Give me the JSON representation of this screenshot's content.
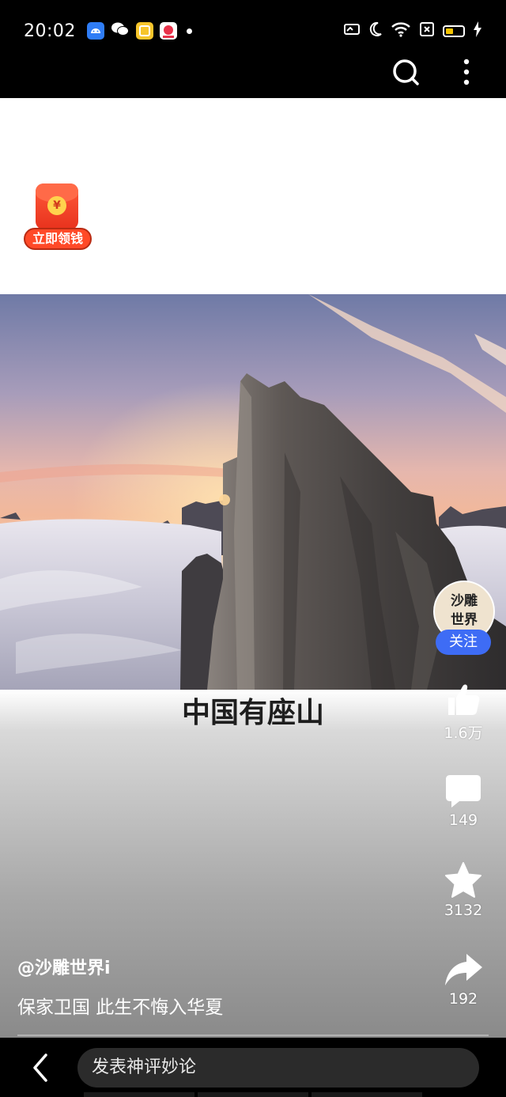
{
  "status_bar": {
    "time": "20:02",
    "notification_icons": [
      "android-icon",
      "wechat-icon",
      "notes-icon",
      "shopping-icon"
    ],
    "system_icons": [
      "screen-cast-icon",
      "moon-icon",
      "wifi-icon",
      "sim-off-icon",
      "battery-icon",
      "charging-icon"
    ],
    "battery_level": 0.3,
    "battery_color": "#f5c400"
  },
  "top_toolbar": {
    "icons": [
      "search-icon",
      "more-vertical-icon"
    ]
  },
  "red_packet": {
    "coin_symbol": "¥",
    "label": "立即领钱",
    "color": "#ff4a28"
  },
  "video": {
    "caption": "中国有座山"
  },
  "creator": {
    "avatar_text_line1": "沙雕",
    "avatar_text_line2": "世界",
    "follow_label": "关注",
    "follow_color": "#3e6cf5"
  },
  "actions": {
    "like_count": "1.6万",
    "comment_count": "149",
    "favorite_count": "3132",
    "share_count": "192"
  },
  "post": {
    "author": "@沙雕世界i",
    "description": "保家卫国 此生不悔入华夏"
  },
  "bottom_bar": {
    "comment_placeholder": "发表神评妙论"
  }
}
